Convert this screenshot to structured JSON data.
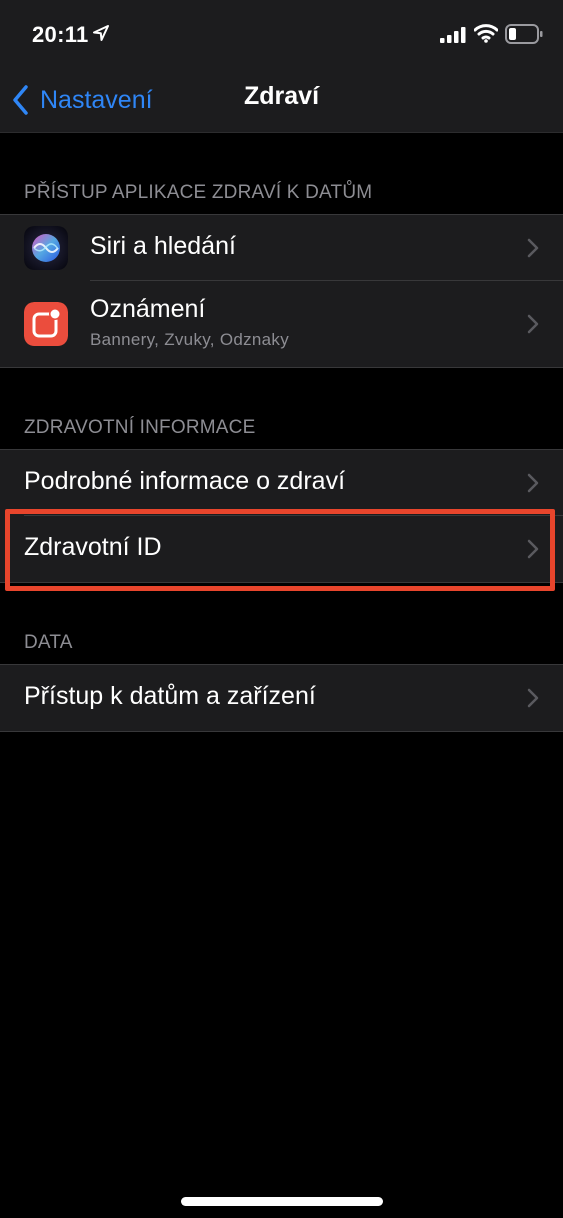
{
  "status_bar": {
    "time": "20:11",
    "icons": [
      "location-arrow-icon",
      "cellular-signal-icon",
      "wifi-icon",
      "battery-icon"
    ]
  },
  "nav": {
    "back_label": "Nastavení",
    "title": "Zdraví"
  },
  "sections": {
    "access": {
      "header": "PŘÍSTUP APLIKACE ZDRAVÍ K DATŮM",
      "siri": {
        "title": "Siri a hledání",
        "icon": "siri-icon"
      },
      "notifications": {
        "title": "Oznámení",
        "subtitle": "Bannery, Zvuky, Odznaky",
        "icon": "notifications-icon"
      }
    },
    "health_info": {
      "header": "ZDRAVOTNÍ INFORMACE",
      "details": {
        "title": "Podrobné informace o zdraví"
      },
      "medical_id": {
        "title": "Zdravotní ID"
      }
    },
    "data": {
      "header": "DATA",
      "access_devices": {
        "title": "Přístup k datům a zařízení"
      }
    }
  },
  "colors": {
    "accent_blue": "#2f86f6",
    "highlight_red": "#e8452c",
    "notification_red": "#eb4d3d",
    "background": "#000000",
    "cell": "#1c1c1e"
  }
}
